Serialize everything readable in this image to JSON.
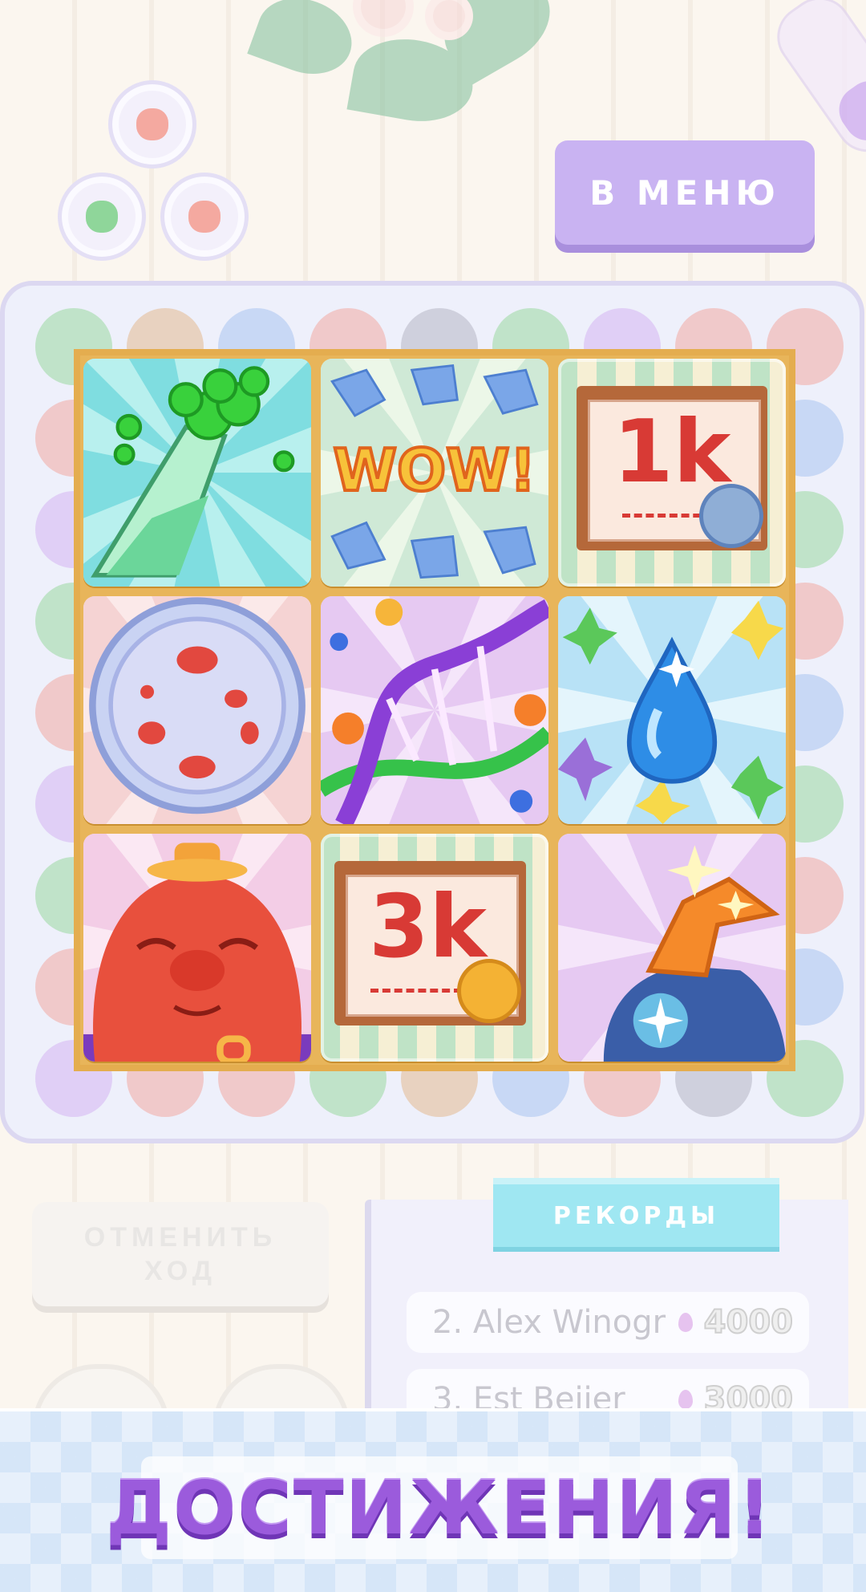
{
  "header": {
    "menu_button": "В МЕНЮ"
  },
  "achievements": {
    "tiles": [
      {
        "id": "green-flask-achievement",
        "label": ""
      },
      {
        "id": "wow-achievement",
        "label": "WOW!"
      },
      {
        "id": "score-1k-achievement",
        "label": "1k"
      },
      {
        "id": "petri-dish-achievement",
        "label": ""
      },
      {
        "id": "dna-achievement",
        "label": ""
      },
      {
        "id": "water-drop-achievement",
        "label": ""
      },
      {
        "id": "blob-creature-achievement",
        "label": ""
      },
      {
        "id": "score-3k-achievement",
        "label": "3k"
      },
      {
        "id": "spray-bottle-achievement",
        "label": ""
      }
    ]
  },
  "controls": {
    "undo_button": "ОТМЕНИТЬ ХОД"
  },
  "records": {
    "title": "РЕКОРДЫ",
    "rows": [
      {
        "rank_name": "2. Alex Winogr",
        "score": "4000"
      },
      {
        "rank_name": "3. Est Beijer",
        "score": "3000"
      }
    ]
  },
  "banner": {
    "title": "ДОСТИЖЕНИЯ!"
  },
  "colors": {
    "menu_button": "#c9b3f2",
    "records_tab": "#9fe7f2",
    "banner_text": "#9b5bdc",
    "tile_frame": "#e8b55a"
  }
}
